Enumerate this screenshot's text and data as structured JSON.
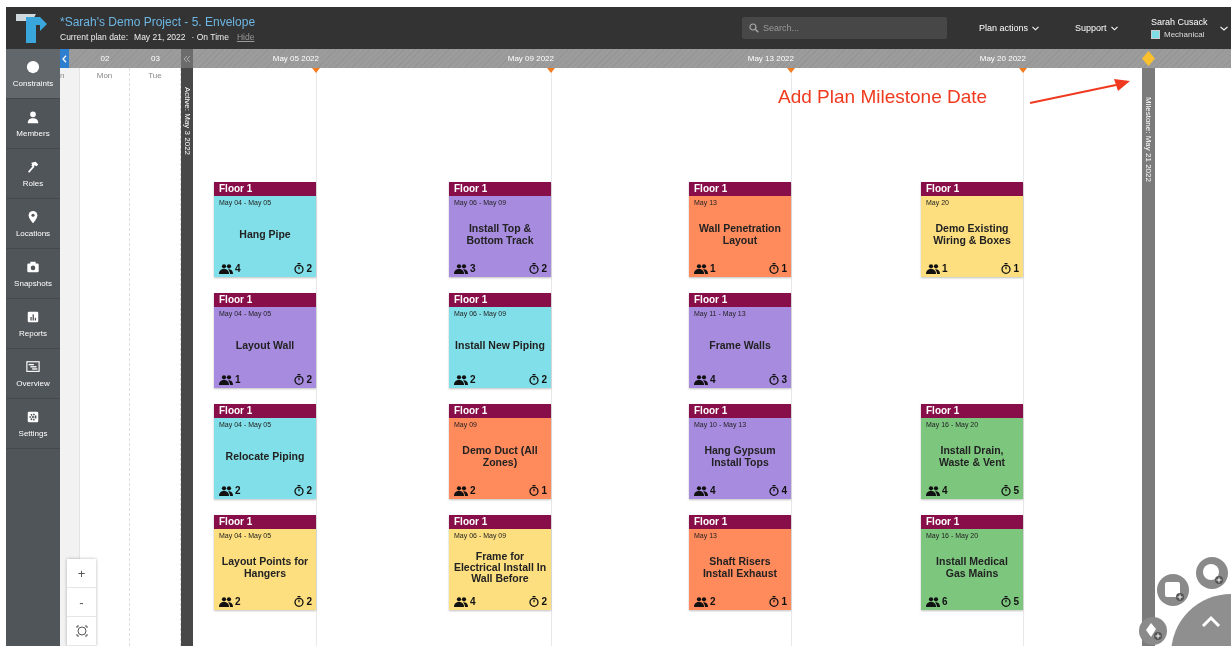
{
  "header": {
    "title": "*Sarah's Demo Project - 5. Envelope",
    "plan_date_label": "Current plan date:",
    "plan_date": "May 21, 2022",
    "status": "· On Time",
    "hide_link": "Hide",
    "search": {
      "placeholder": "Search..."
    },
    "menus": [
      {
        "label": "Plan actions"
      },
      {
        "label": "Support"
      }
    ],
    "user": {
      "name": "Sarah Cusack",
      "role": "Mechanical"
    }
  },
  "sidebar": {
    "items": [
      {
        "label": "Constraints",
        "selected": true
      },
      {
        "label": "Members",
        "selected": false
      },
      {
        "label": "Roles",
        "selected": false
      },
      {
        "label": "Locations",
        "selected": false
      },
      {
        "label": "Snapshots",
        "selected": false
      },
      {
        "label": "Reports",
        "selected": false
      },
      {
        "label": "Overview",
        "selected": false
      },
      {
        "label": "Settings",
        "selected": false
      }
    ]
  },
  "timeline": {
    "day_numbers": [
      "02",
      "03"
    ],
    "day_names": [
      "n",
      "Mon",
      "Tue"
    ],
    "active_label": "Active: May 3 2022",
    "milestone_label": "Milestone: May 21 2022"
  },
  "board": {
    "columns": [
      {
        "date": "May 05 2022"
      },
      {
        "date": "May 09 2022"
      },
      {
        "date": "May 13 2022"
      },
      {
        "date": "May 20 2022"
      }
    ],
    "rows": [
      [
        {
          "location": "Floor 1",
          "dates": "May 04 - May 05",
          "title": "Hang Pipe",
          "crew": "4",
          "duration": "2",
          "color": "#80dfe8"
        },
        {
          "location": "Floor 1",
          "dates": "May 06 - May 09",
          "title": "Install Top & Bottom Track",
          "crew": "3",
          "duration": "2",
          "color": "#a78bdf"
        },
        {
          "location": "Floor 1",
          "dates": "May 13",
          "title": "Wall Penetration Layout",
          "crew": "1",
          "duration": "1",
          "color": "#ff8a5c"
        },
        {
          "location": "Floor 1",
          "dates": "May 20",
          "title": "Demo Existing Wiring & Boxes",
          "crew": "1",
          "duration": "1",
          "color": "#fddf80"
        }
      ],
      [
        {
          "location": "Floor 1",
          "dates": "May 04 - May 05",
          "title": "Layout Wall",
          "crew": "1",
          "duration": "2",
          "color": "#a78bdf"
        },
        {
          "location": "Floor 1",
          "dates": "May 06 - May 09",
          "title": "Install New Piping",
          "crew": "2",
          "duration": "2",
          "color": "#80dfe8"
        },
        {
          "location": "Floor 1",
          "dates": "May 11 - May 13",
          "title": "Frame Walls",
          "crew": "4",
          "duration": "3",
          "color": "#a78bdf"
        }
      ],
      [
        {
          "location": "Floor 1",
          "dates": "May 04 - May 05",
          "title": "Relocate Piping",
          "crew": "2",
          "duration": "2",
          "color": "#80dfe8"
        },
        {
          "location": "Floor 1",
          "dates": "May 09",
          "title": "Demo Duct (All Zones)",
          "crew": "2",
          "duration": "1",
          "color": "#ff8a5c"
        },
        {
          "location": "Floor 1",
          "dates": "May 10 - May 13",
          "title": "Hang Gypsum Install Tops",
          "crew": "4",
          "duration": "4",
          "color": "#a78bdf"
        },
        {
          "location": "Floor 1",
          "dates": "May 16 - May 20",
          "title": "Install Drain, Waste & Vent",
          "crew": "4",
          "duration": "5",
          "color": "#7dc67e"
        }
      ],
      [
        {
          "location": "Floor 1",
          "dates": "May 04 - May 05",
          "title": "Layout Points for Hangers",
          "crew": "2",
          "duration": "2",
          "color": "#fddf80"
        },
        {
          "location": "Floor 1",
          "dates": "May 06 - May 09",
          "title": "Frame for Electrical Install In Wall Before",
          "crew": "4",
          "duration": "2",
          "color": "#fddf80"
        },
        {
          "location": "Floor 1",
          "dates": "May 13",
          "title": "Shaft Risers Install Exhaust",
          "crew": "2",
          "duration": "1",
          "color": "#ff8a5c"
        },
        {
          "location": "Floor 1",
          "dates": "May 16 - May 20",
          "title": "Install Medical Gas Mains",
          "crew": "6",
          "duration": "5",
          "color": "#7dc67e"
        }
      ]
    ]
  },
  "annotation": {
    "text": "Add Plan Milestone Date"
  },
  "zoom_controls": {
    "zoom_in": "+",
    "zoom_out": "-"
  }
}
